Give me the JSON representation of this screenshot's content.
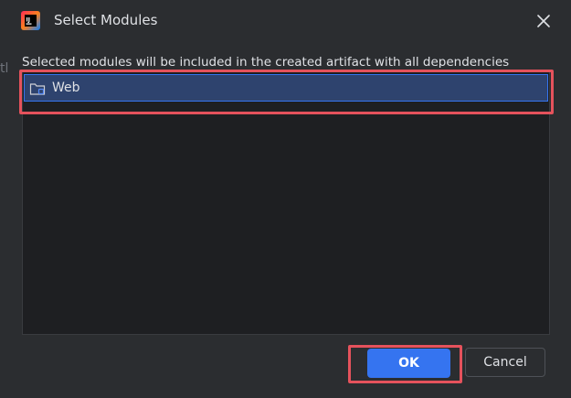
{
  "window": {
    "title": "Select Modules",
    "icon": "intellij-idea-icon",
    "close_icon": "close-icon"
  },
  "background_text": "tl",
  "description": "Selected modules will be included in the created artifact with all dependencies",
  "modules": [
    {
      "name": "Web",
      "icon": "module-folder-icon",
      "selected": true
    }
  ],
  "buttons": {
    "ok": "OK",
    "cancel": "Cancel"
  },
  "colors": {
    "accent": "#3574f0",
    "selection_bg": "#2e436e",
    "highlight_annotation": "#e5525c",
    "dialog_bg": "#2b2d30",
    "list_bg": "#1e1f22"
  }
}
